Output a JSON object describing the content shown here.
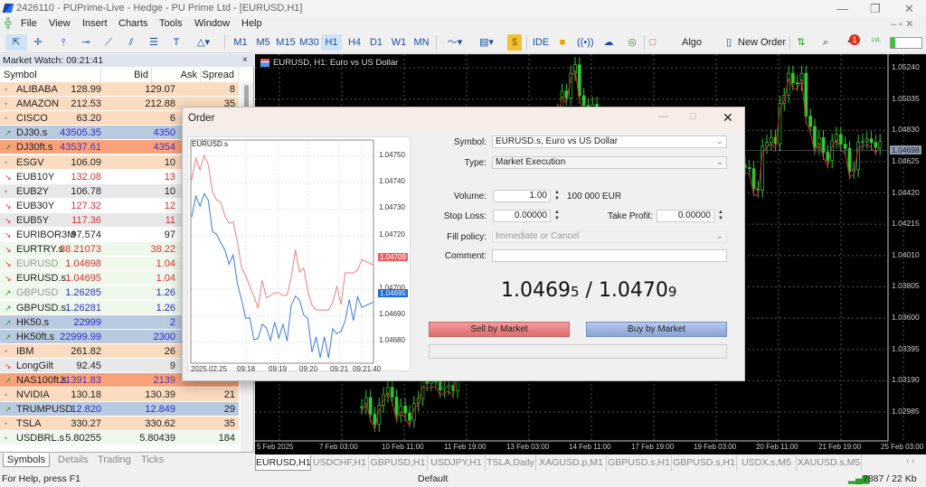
{
  "window": {
    "title": "2426110 - PUPrime-Live - Hedge - PU Prime Ltd - [EURUSD,H1]"
  },
  "menu": [
    "File",
    "View",
    "Insert",
    "Charts",
    "Tools",
    "Window",
    "Help"
  ],
  "timeframes": [
    "M1",
    "M5",
    "M15",
    "M30",
    "H1",
    "H4",
    "D1",
    "W1",
    "MN"
  ],
  "toolbar": {
    "ide": "IDE",
    "algo": "Algo Trading",
    "new_order": "New Order",
    "notif_count": "1",
    "lvl": "LVL"
  },
  "market_watch": {
    "title": "Market Watch: 09:21:41",
    "close": "×",
    "columns": [
      "Symbol",
      "Bid",
      "Ask",
      "Spread"
    ],
    "rows": [
      {
        "dir": "•",
        "symbol": "ALIBABA",
        "bid": "128.99",
        "ask": "129.07",
        "spread": "8",
        "bg": "#fcdcc0",
        "color": "#222"
      },
      {
        "dir": "•",
        "symbol": "AMAZON",
        "bid": "212.53",
        "ask": "212.88",
        "spread": "35",
        "bg": "#fcdcc0",
        "color": "#222"
      },
      {
        "dir": "•",
        "symbol": "CISCO",
        "bid": "63.20",
        "ask": "6",
        "spread": "",
        "bg": "#fcdcc0",
        "color": "#222"
      },
      {
        "dir": "↗",
        "symbol": "DJ30.s",
        "bid": "43505.35",
        "ask": "4350",
        "spread": "",
        "bg": "#b9c9df",
        "color": "#2a2ad0"
      },
      {
        "dir": "↗",
        "symbol": "DJ30ft.s",
        "bid": "43537.61",
        "ask": "4354",
        "spread": "",
        "bg": "#f9a27a",
        "color": "#5030b0"
      },
      {
        "dir": "•",
        "symbol": "ESGV",
        "bid": "106.09",
        "ask": "10",
        "spread": "",
        "bg": "#fcdcc0",
        "color": "#222"
      },
      {
        "dir": "↘",
        "symbol": "EUB10Y",
        "bid": "132.08",
        "ask": "13",
        "spread": "",
        "bg": "#ffffff",
        "color": "#e03030"
      },
      {
        "dir": "•",
        "symbol": "EUB2Y",
        "bid": "106.78",
        "ask": "10",
        "spread": "",
        "bg": "#e8e8e8",
        "color": "#222"
      },
      {
        "dir": "↘",
        "symbol": "EUB30Y",
        "bid": "127.32",
        "ask": "12",
        "spread": "",
        "bg": "#ffffff",
        "color": "#e03030"
      },
      {
        "dir": "↘",
        "symbol": "EUB5Y",
        "bid": "117.36",
        "ask": "11",
        "spread": "",
        "bg": "#e8e8e8",
        "color": "#e03030"
      },
      {
        "dir": "↘",
        "symbol": "EURIBOR3M",
        "bid": "97.574",
        "ask": "97",
        "spread": "",
        "bg": "#ffffff",
        "color": "#222"
      },
      {
        "dir": "↘",
        "symbol": "EURTRY.s",
        "bid": "38.21073",
        "ask": "38.22",
        "spread": "",
        "bg": "#eef9ec",
        "color": "#e03030"
      },
      {
        "dir": "↘",
        "symbol": "EURUSD",
        "bid": "1.04698",
        "ask": "1.04",
        "spread": "",
        "bg": "#eef9ec",
        "color": "#e03030",
        "dim": true
      },
      {
        "dir": "↘",
        "symbol": "EURUSD.s",
        "bid": "1.04695",
        "ask": "1.04",
        "spread": "",
        "bg": "#eef9ec",
        "color": "#e03030"
      },
      {
        "dir": "↗",
        "symbol": "GBPUSD",
        "bid": "1.26285",
        "ask": "1.26",
        "spread": "",
        "bg": "#eef9ec",
        "color": "#2a2ad0",
        "dim": true
      },
      {
        "dir": "↗",
        "symbol": "GBPUSD.s",
        "bid": "1.26281",
        "ask": "1.26",
        "spread": "",
        "bg": "#eef9ec",
        "color": "#2a2ad0"
      },
      {
        "dir": "↗",
        "symbol": "HK50.s",
        "bid": "22999",
        "ask": "2",
        "spread": "",
        "bg": "#b9c9df",
        "color": "#2a2ad0"
      },
      {
        "dir": "↗",
        "symbol": "HK50ft.s",
        "bid": "22999.99",
        "ask": "2300",
        "spread": "",
        "bg": "#b9c9df",
        "color": "#2a2ad0"
      },
      {
        "dir": "•",
        "symbol": "IBM",
        "bid": "261.82",
        "ask": "26",
        "spread": "",
        "bg": "#fcdcc0",
        "color": "#222"
      },
      {
        "dir": "↘",
        "symbol": "LongGilt",
        "bid": "92.45",
        "ask": "9",
        "spread": "",
        "bg": "#e8e8e8",
        "color": "#222"
      },
      {
        "dir": "↗",
        "symbol": "NAS100ft.s",
        "bid": "21391.83",
        "ask": "2139",
        "spread": "",
        "bg": "#f9a27a",
        "color": "#5030b0"
      },
      {
        "dir": "•",
        "symbol": "NVIDIA",
        "bid": "130.18",
        "ask": "130.39",
        "spread": "21",
        "bg": "#fcdcc0",
        "color": "#222"
      },
      {
        "dir": "↗",
        "symbol": "TRUMPUSD",
        "bid": "12.820",
        "ask": "12.849",
        "spread": "29",
        "bg": "#b9c9df",
        "color": "#2a2ad0"
      },
      {
        "dir": "•",
        "symbol": "TSLA",
        "bid": "330.27",
        "ask": "330.62",
        "spread": "35",
        "bg": "#fcdcc0",
        "color": "#222"
      },
      {
        "dir": "•",
        "symbol": "USDBRL.s",
        "bid": "5.80255",
        "ask": "5.80439",
        "spread": "184",
        "bg": "#eef9ec",
        "color": "#222"
      }
    ],
    "tabs": [
      "Symbols",
      "Details",
      "Trading",
      "Ticks"
    ]
  },
  "chart": {
    "title": "EURUSD, H1:  Euro vs US Dollar",
    "current_price": "1.04698",
    "price_labels": [
      "1.05240",
      "1.05035",
      "1.04830",
      "1.04625",
      "1.04420",
      "1.04215",
      "1.04010",
      "1.03805",
      "1.03600",
      "1.03395",
      "1.03190",
      "1.02985"
    ],
    "time_labels": [
      "5 Feb 2025",
      "7 Feb 03:00",
      "10 Feb 11:00",
      "11 Feb 19:00",
      "13 Feb 03:00",
      "14 Feb 11:00",
      "17 Feb 19:00",
      "19 Feb 03:00",
      "20 Feb 11:00",
      "21 Feb 19:00",
      "25 Feb 03:00"
    ],
    "closes": [
      1.0302,
      1.0296,
      1.0305,
      1.0312,
      1.03,
      1.0294,
      1.0308,
      1.0315,
      1.0322,
      1.031,
      1.0318,
      1.033,
      1.0345,
      1.036,
      1.0372,
      1.0385,
      1.0395,
      1.041,
      1.0425,
      1.044,
      1.0455,
      1.047,
      1.049,
      1.051,
      1.052,
      1.0505,
      1.0495,
      1.048,
      1.047,
      1.046,
      1.045,
      1.044,
      1.043,
      1.042,
      1.041,
      1.0405,
      1.04,
      1.042,
      1.044,
      1.045,
      1.0465,
      1.0478,
      1.047,
      1.0462,
      1.0455,
      1.0448,
      1.047,
      1.048,
      1.05,
      1.052,
      1.0515,
      1.049,
      1.0475,
      1.0465,
      1.048,
      1.047,
      1.046,
      1.0472,
      1.048,
      1.047
    ]
  },
  "chart_tabs": [
    "EURUSD,H1",
    "USDCHF,H1",
    "GBPUSD,H1",
    "USDJPY,H1",
    "TSLA,Daily",
    "XAGUSD.p,M1",
    "GBPUSD.s,H1",
    "GBPUSD.s,H1",
    "USDX.s,M5",
    "XAUUSD.s,M5"
  ],
  "status": {
    "help": "For Help, press F1",
    "profile": "Default",
    "traffic": "7887 / 22 Kb"
  },
  "order": {
    "title": "Order",
    "symbol_label": "Symbol:",
    "symbol": "EURUSD.s, Euro vs US Dollar",
    "type_label": "Type:",
    "type": "Market Execution",
    "volume_label": "Volume:",
    "volume": "1.00",
    "volume_note": "100 000 EUR",
    "sl_label": "Stop Loss:",
    "sl": "0.00000",
    "tp_label": "Take Profit:",
    "tp": "0.00000",
    "fill_label": "Fill policy:",
    "fill": "Immediate or Cancel",
    "comment_label": "Comment:",
    "comment": "",
    "bid_main": "1.0469",
    "bid_last": "5",
    "sep": " / ",
    "ask_main": "1.0470",
    "ask_last": "9",
    "sell": "Sell by Market",
    "buy": "Buy by Market",
    "mini_chart": {
      "symbol": "EURUSD.s",
      "bid_tag": "1.04695",
      "ask_tag": "1.04709",
      "y_labels": [
        "1.04750",
        "1.04740",
        "1.04730",
        "1.04720",
        "1.04700",
        "1.04690",
        "1.04680"
      ],
      "x_labels": [
        "2025.02.25",
        "09:18",
        "09:19",
        "09:20",
        "09:21",
        "09:21:40"
      ],
      "ylim": [
        1.04672,
        1.04756
      ],
      "spread": 0.00014,
      "bid": [
        1.04727,
        1.04735,
        1.04731,
        1.04736,
        1.04733,
        1.04722,
        1.0472,
        1.04718,
        1.04714,
        1.0471,
        1.04712,
        1.04703,
        1.04695,
        1.0469,
        1.04688,
        1.04682,
        1.0468,
        1.04688,
        1.04684,
        1.04682,
        1.04686,
        1.04683,
        1.04685,
        1.04682,
        1.04692,
        1.04699,
        1.04694,
        1.04692,
        1.04687,
        1.04678,
        1.0468,
        1.04676,
        1.0468,
        1.04676,
        1.04683,
        1.04685,
        1.04682,
        1.0469,
        1.04694,
        1.0469,
        1.04695,
        1.04695
      ]
    }
  }
}
